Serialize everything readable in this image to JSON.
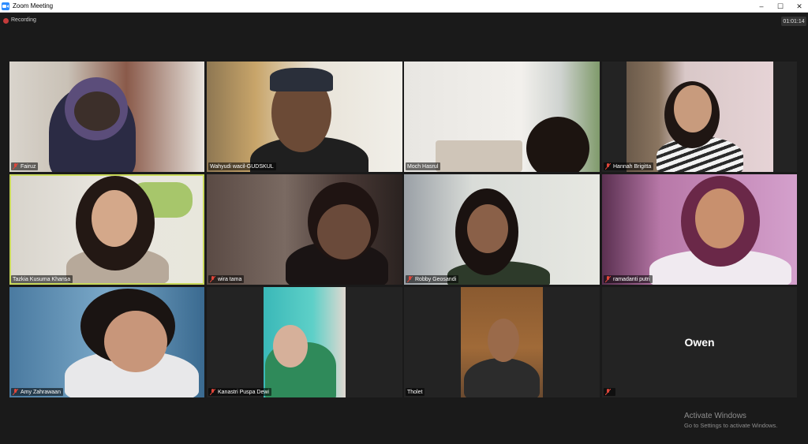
{
  "window": {
    "title": "Zoom Meeting",
    "minimize": "–",
    "maximize": "☐",
    "close": "✕"
  },
  "recording": {
    "label": "Recording"
  },
  "timer": "01:01:14",
  "participants": [
    {
      "name": "Fairuz"
    },
    {
      "name": "Wahyudi wacil-GUDSKUL"
    },
    {
      "name": "Moch Hasrul"
    },
    {
      "name": "Hannah Brigitta"
    },
    {
      "name": "Tazkia Kusuma Khansa"
    },
    {
      "name": "wira tama"
    },
    {
      "name": "Robby Geosandi"
    },
    {
      "name": "ramadanti putri"
    },
    {
      "name": "Amy Zahrawaan"
    },
    {
      "name": "Kanastri Puspa Dewi"
    },
    {
      "name": "Tholet"
    },
    {
      "name": "Owen"
    }
  ],
  "watermark": {
    "line1": "Activate Windows",
    "line2": "Go to Settings to activate Windows."
  },
  "colors": {
    "background": "#1a1a1a",
    "active_speaker": "#c9d95a",
    "mic_muted": "#e0463a",
    "recording": "#c43b3b"
  },
  "icons": {
    "mic": "mic-muted-icon",
    "recording": "recording-dot-icon",
    "app": "zoom-app-icon"
  }
}
